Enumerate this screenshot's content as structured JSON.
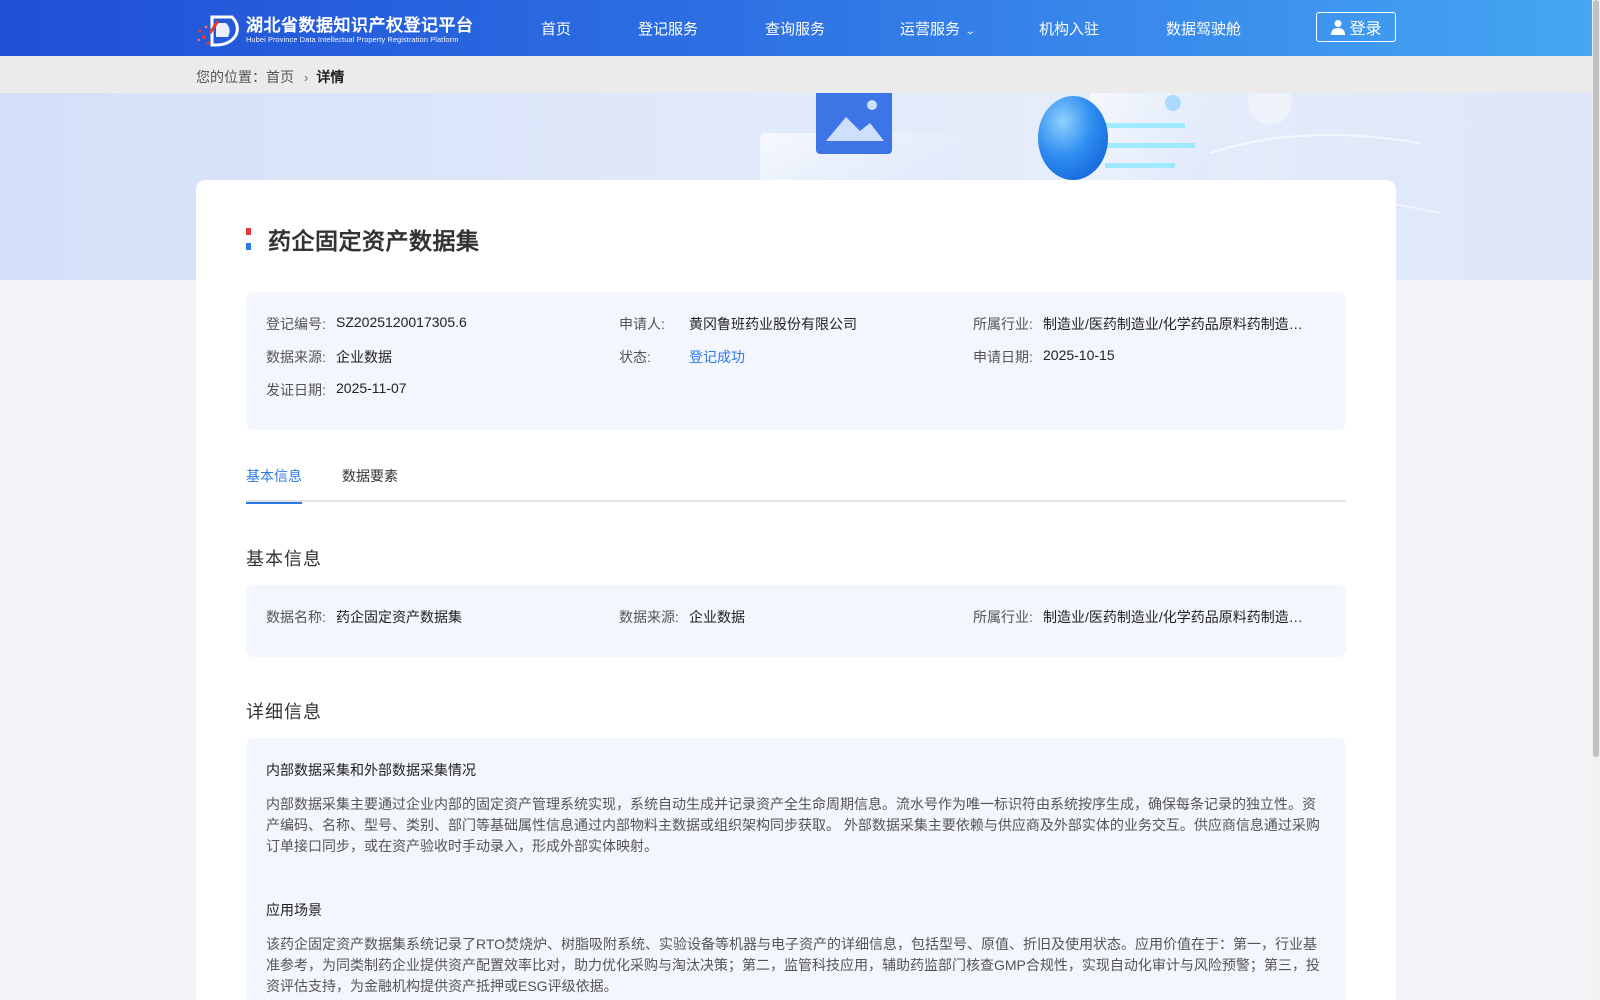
{
  "header": {
    "logo_title": "湖北省数据知识产权登记平台",
    "logo_subtitle": "Hubei Province Data Intellectual Property Registration Platform",
    "nav": [
      "首页",
      "登记服务",
      "查询服务",
      "运营服务",
      "机构入驻",
      "数据驾驶舱"
    ],
    "login_label": "登录",
    "colors": {
      "header_start": "#1f4fd6",
      "header_end": "#45a6f3"
    }
  },
  "breadcrumb": {
    "prefix": "您的位置：",
    "home": "首页",
    "current": "详情"
  },
  "page": {
    "title": "药企固定资产数据集",
    "summary": {
      "reg_no": {
        "label": "登记编号:",
        "value": "SZ2025120017305.6"
      },
      "applicant": {
        "label": "申请人:",
        "value": "黄冈鲁班药业股份有限公司"
      },
      "industry": {
        "label": "所属行业:",
        "value": "制造业/医药制造业/化学药品原料药制造/化学药品原料药制造"
      },
      "source": {
        "label": "数据来源:",
        "value": "企业数据"
      },
      "status": {
        "label": "状态:",
        "value": "登记成功"
      },
      "apply_date": {
        "label": "申请日期:",
        "value": "2025-10-15"
      },
      "cert_date": {
        "label": "发证日期:",
        "value": "2025-11-07"
      }
    },
    "tabs": [
      "基本信息",
      "数据要素"
    ],
    "active_tab": "基本信息",
    "basic": {
      "heading": "基本信息",
      "name": {
        "label": "数据名称:",
        "value": "药企固定资产数据集"
      },
      "source": {
        "label": "数据来源:",
        "value": "企业数据"
      },
      "industry": {
        "label": "所属行业:",
        "value": "制造业/医药制造业/化学药品原料药制造/化学药品原料药制造"
      }
    },
    "detail": {
      "heading": "详细信息",
      "sections": [
        {
          "title": "内部数据采集和外部数据采集情况",
          "body": "内部数据采集主要通过企业内部的固定资产管理系统实现，系统自动生成并记录资产全生命周期信息。流水号作为唯一标识符由系统按序生成，确保每条记录的独立性。资产编码、名称、型号、类别、部门等基础属性信息通过内部物料主数据或组织架构同步获取。 外部数据采集主要依赖与供应商及外部实体的业务交互。供应商信息通过采购订单接口同步，或在资产验收时手动录入，形成外部实体映射。"
        },
        {
          "title": "应用场景",
          "body": "该药企固定资产数据集系统记录了RTO焚烧炉、树脂吸附系统、实验设备等机器与电子资产的详细信息，包括型号、原值、折旧及使用状态。应用价值在于：第一，行业基准参考，为同类制药企业提供资产配置效率比对，助力优化采购与淘汰决策；第二，监管科技应用，辅助药监部门核查GMP合规性，实现自动化审计与风险预警；第三，投资评估支持，为金融机构提供资产抵押或ESG评级依据。"
        }
      ]
    },
    "colors": {
      "accent": "#2c7ae6",
      "panel_bg": "#f3f6fd"
    }
  }
}
